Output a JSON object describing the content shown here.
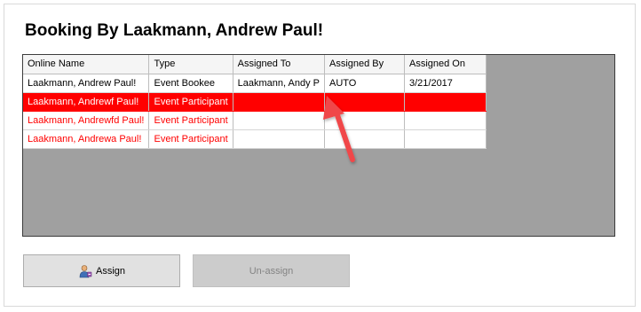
{
  "title": "Booking By Laakmann, Andrew Paul!",
  "grid": {
    "columns": [
      "Online Name",
      "Type",
      "Assigned To",
      "Assigned By",
      "Assigned On"
    ],
    "rows": [
      {
        "online_name": "Laakmann, Andrew Paul!",
        "type": "Event Bookee",
        "assigned_to": "Laakmann, Andy P",
        "assigned_by": "AUTO",
        "assigned_on": "3/21/2017"
      },
      {
        "online_name": "Laakmann, Andrewf Paul!",
        "type": "Event Participant",
        "assigned_to": "",
        "assigned_by": "",
        "assigned_on": ""
      },
      {
        "online_name": "Laakmann, Andrewfd Paul!",
        "type": "Event Participant",
        "assigned_to": "",
        "assigned_by": "",
        "assigned_on": ""
      },
      {
        "online_name": "Laakmann, Andrewa Paul!",
        "type": "Event Participant",
        "assigned_to": "",
        "assigned_by": "",
        "assigned_on": ""
      }
    ],
    "selected_row": 1
  },
  "buttons": {
    "assign_label": "Assign",
    "assign_icon": "user-assign-icon",
    "unassign_label": "Un-assign",
    "unassign_enabled": false
  },
  "colors": {
    "selected_row": "#ff0000",
    "participant_text": "#ff0000",
    "annotation_arrow": "#f0474a"
  }
}
